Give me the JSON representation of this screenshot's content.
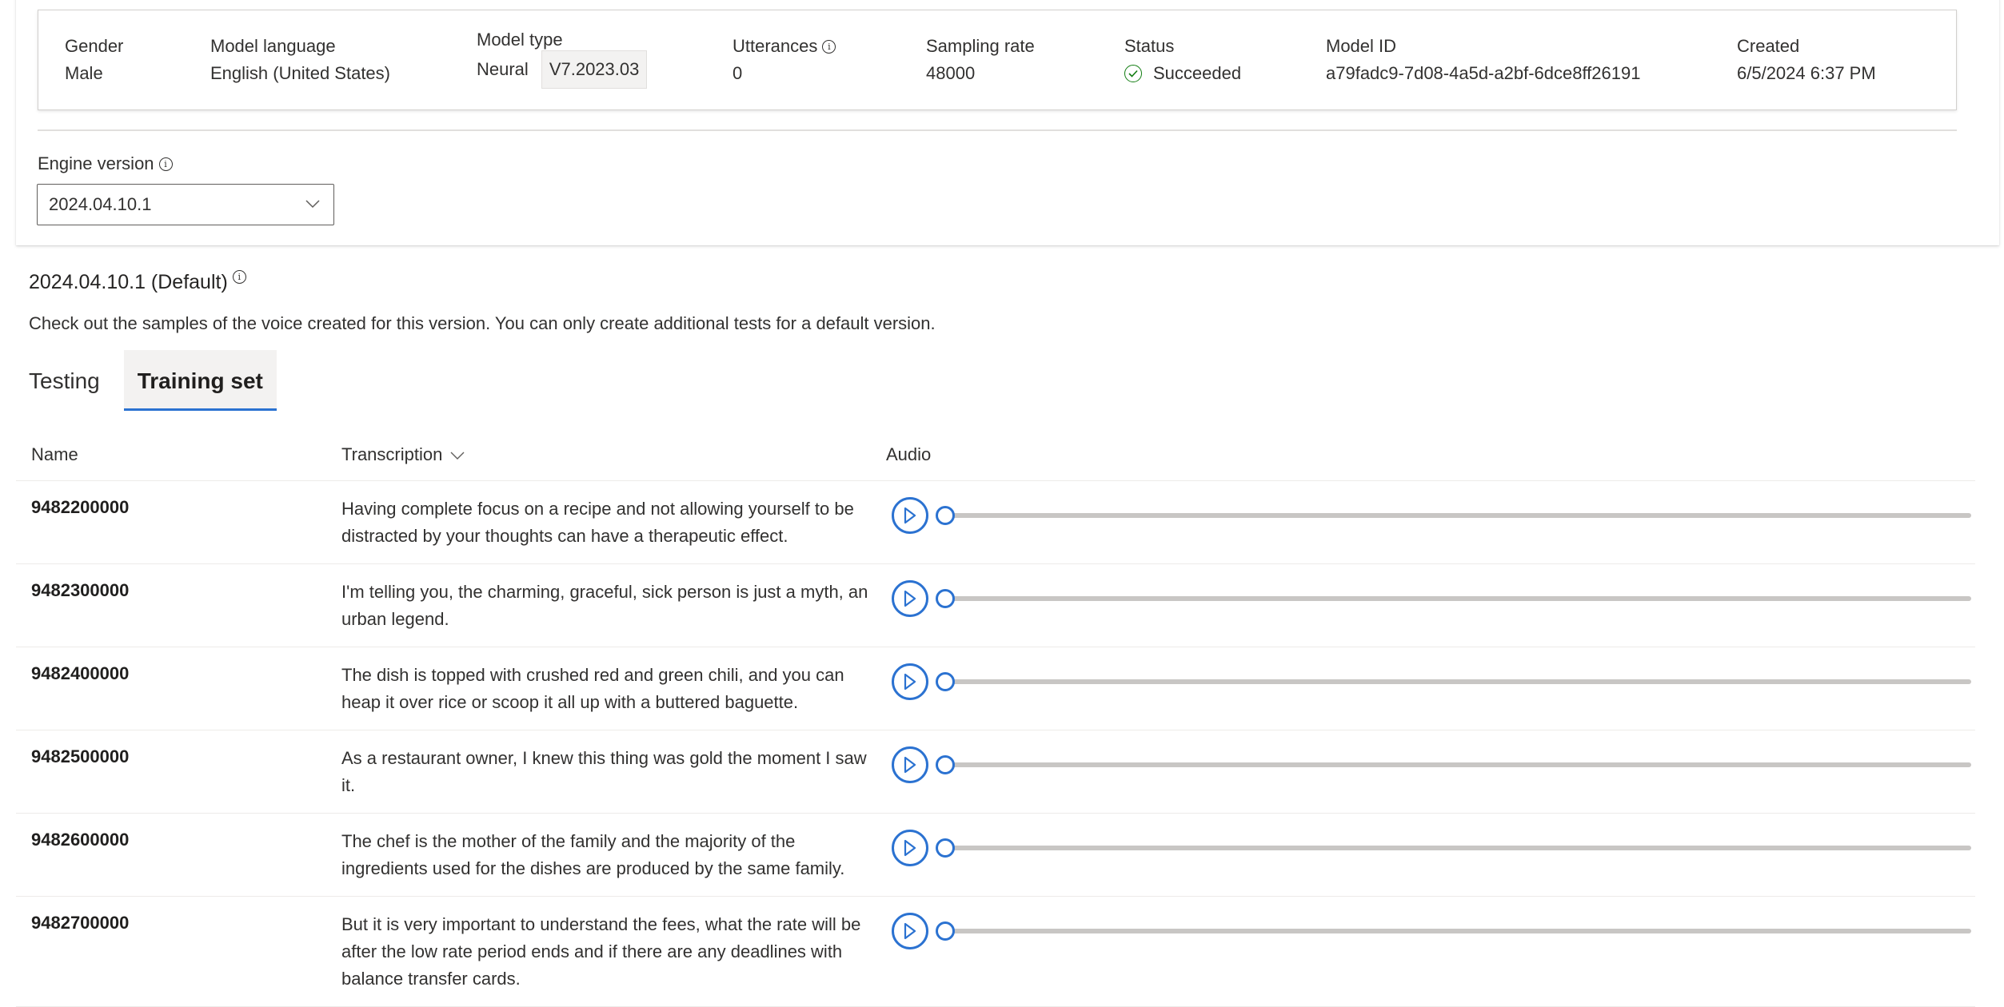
{
  "model_info": {
    "gender": {
      "label": "Gender",
      "value": "Male"
    },
    "language": {
      "label": "Model language",
      "value": "English (United States)"
    },
    "model_type": {
      "label": "Model type",
      "value": "Neural",
      "version": "V7.2023.03"
    },
    "utterances": {
      "label": "Utterances",
      "value": "0",
      "info_icon": "info-icon"
    },
    "sampling_rate": {
      "label": "Sampling rate",
      "value": "48000"
    },
    "status": {
      "label": "Status",
      "value": "Succeeded",
      "icon": "check-circle-icon",
      "color": "#107c10"
    },
    "model_id": {
      "label": "Model ID",
      "value": "a79fadc9-7d08-4a5d-a2bf-6dce8ff26191"
    },
    "created": {
      "label": "Created",
      "value": "6/5/2024 6:37 PM"
    }
  },
  "engine_version": {
    "label": "Engine version",
    "info_icon": "info-icon",
    "selected": "2024.04.10.1"
  },
  "version_section": {
    "title": "2024.04.10.1 (Default)",
    "description": "Check out the samples of the voice created for this version. You can only create additional tests for a default version."
  },
  "tabs": [
    {
      "label": "Testing",
      "selected": false
    },
    {
      "label": "Training set",
      "selected": true
    }
  ],
  "table": {
    "columns": {
      "name": "Name",
      "transcription": "Transcription",
      "audio": "Audio"
    },
    "rows": [
      {
        "name": "9482200000",
        "transcription": "Having complete focus on a recipe and not allowing yourself to be distracted by your thoughts can have a therapeutic effect.",
        "progress": 0
      },
      {
        "name": "9482300000",
        "transcription": "I'm telling you, the charming, graceful, sick person is just a myth, an urban legend.",
        "progress": 0
      },
      {
        "name": "9482400000",
        "transcription": "The dish is topped with crushed red and green chili, and you can heap it over rice or scoop it all up with a buttered baguette.",
        "progress": 0
      },
      {
        "name": "9482500000",
        "transcription": "As a restaurant owner, I knew this thing was gold the moment I saw it.",
        "progress": 0
      },
      {
        "name": "9482600000",
        "transcription": "The chef is the mother of the family and the majority of the ingredients used for the dishes are produced by the same family.",
        "progress": 0
      },
      {
        "name": "9482700000",
        "transcription": "But it is very important to understand the fees, what the rate will be after the low rate period ends and if there are any deadlines with balance transfer cards.",
        "progress": 0
      }
    ]
  },
  "colors": {
    "accent": "#2b72d1",
    "success": "#107c10",
    "track": "#c8c6c4"
  }
}
